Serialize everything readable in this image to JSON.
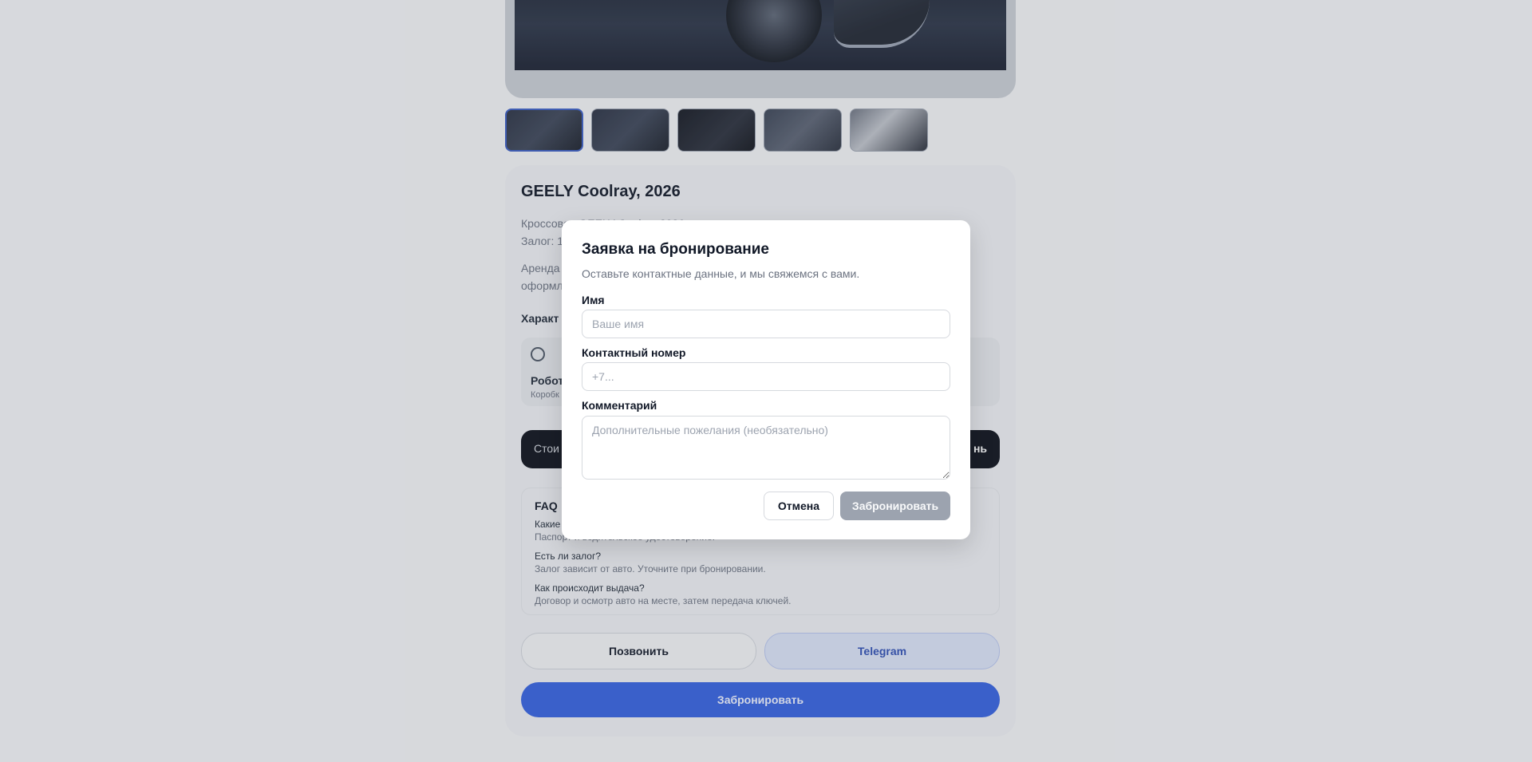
{
  "car": {
    "title": "GEELY Coolray, 2026",
    "desc_line1": "Кроссовер GEELY Coolray 2026 г.",
    "desc_line2": "Залог: 1",
    "rent_line1": "Аренда",
    "rent_line2": "оформл"
  },
  "specs": {
    "heading": "Характ",
    "gearbox_value": "Робот",
    "gearbox_label": "Коробк",
    "gearbox_icon": "speedometer-icon"
  },
  "price": {
    "label": "Стои",
    "unit": "нь"
  },
  "faq": {
    "title": "FAQ",
    "items": [
      {
        "q": "Какие",
        "a": "Паспорт и водительское удостоверение."
      },
      {
        "q": "Есть ли залог?",
        "a": "Залог зависит от авто. Уточните при бронировании."
      },
      {
        "q": "Как происходит выдача?",
        "a": "Договор и осмотр авто на месте, затем передача ключей."
      }
    ]
  },
  "actions": {
    "call": "Позвонить",
    "telegram": "Telegram",
    "book": "Забронировать"
  },
  "modal": {
    "title": "Заявка на бронирование",
    "subtitle": "Оставьте контактные данные, и мы свяжемся с вами.",
    "name_label": "Имя",
    "name_placeholder": "Ваше имя",
    "phone_label": "Контактный номер",
    "phone_placeholder": "+7...",
    "comment_label": "Комментарий",
    "comment_placeholder": "Дополнительные пожелания (необязательно)",
    "cancel": "Отмена",
    "submit": "Забронировать"
  },
  "colors": {
    "accent": "#3461e0",
    "submit_disabled": "#9ca3af",
    "dark_bar": "#0b0f19"
  }
}
